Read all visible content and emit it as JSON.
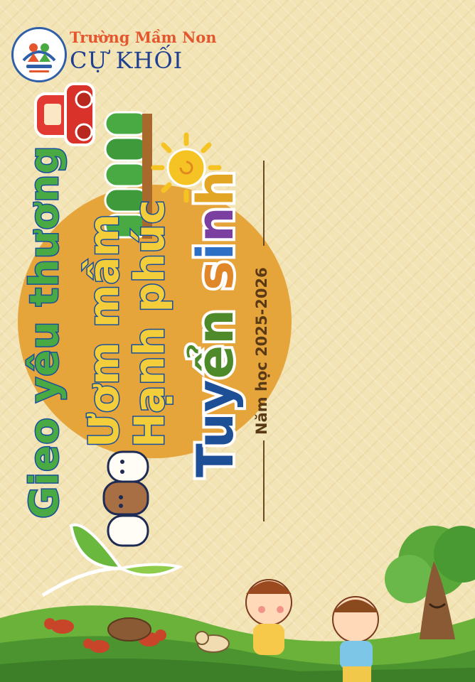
{
  "school": {
    "name_line1": "Trường Mầm Non",
    "name_line2": "CỰ KHỐI",
    "logo_icon": "school-logo-icon"
  },
  "slogan": {
    "line1": "Gieo yêu thương",
    "line2": "Ươm mầm",
    "line3": "Hạnh phúc"
  },
  "headline": {
    "letters": [
      {
        "char": "T",
        "color": "#1d4f96"
      },
      {
        "char": "u",
        "color": "#1d4f96"
      },
      {
        "char": "y",
        "color": "#1d4f96"
      },
      {
        "char": "ể",
        "color": "#4e8a2a"
      },
      {
        "char": "n",
        "color": "#4e8a2a"
      },
      {
        "char": " ",
        "color": "#000000"
      },
      {
        "char": "s",
        "color": "#e0872a"
      },
      {
        "char": "i",
        "color": "#2c6fc4"
      },
      {
        "char": "n",
        "color": "#7a3fa0"
      },
      {
        "char": "h",
        "color": "#e3a524"
      }
    ]
  },
  "school_year": "Năm học 2025-2026",
  "colors": {
    "background": "#f3e4b6",
    "sun_disc": "#e6a53b",
    "outline_blue": "#174f9d",
    "slogan_green": "#49a942",
    "slogan_yellow": "#f4ce3a",
    "school_red": "#e4572e",
    "school_navy": "#1f3f8f"
  },
  "decorations": [
    "toy-car-icon",
    "tree-row-icon",
    "sun-icon",
    "bear-stack-icon",
    "sprout-leaf-icon",
    "ants-icon",
    "nut-icon",
    "puppy-icon",
    "girl-icon",
    "boy-icon",
    "tree-icon",
    "grass-hill-icon"
  ]
}
